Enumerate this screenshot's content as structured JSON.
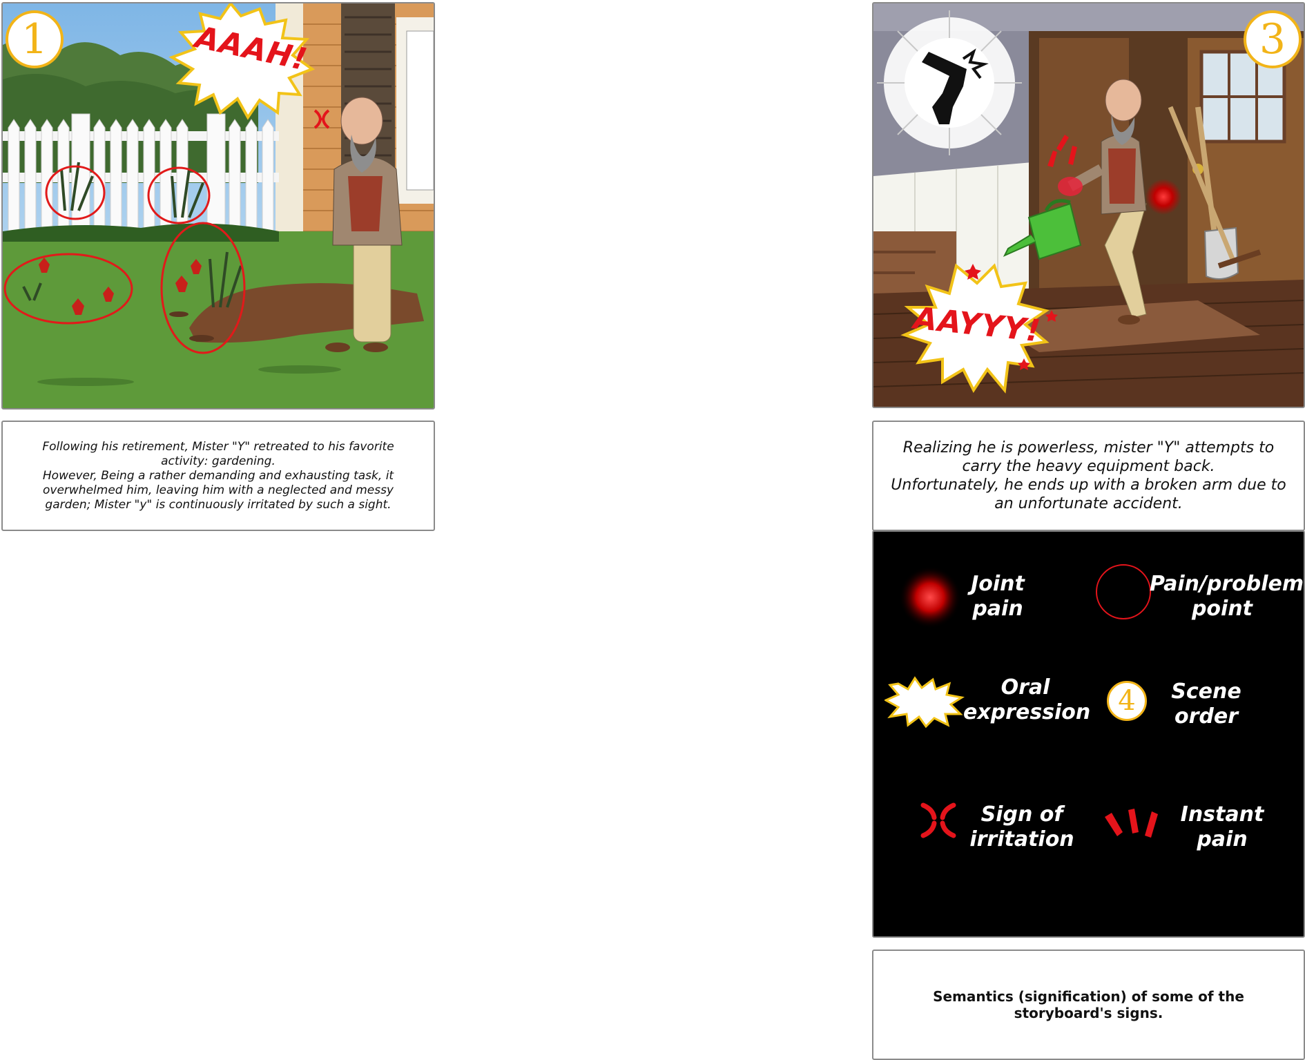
{
  "panel1": {
    "scene_number": "1",
    "exclamation": "AAAH!"
  },
  "caption1": {
    "lines": [
      "Following his retirement, Mister \"Y\" retreated to his favorite",
      "activity: gardening.",
      "However, Being a rather demanding and exhausting task, it",
      "overwhelmed him, leaving him with a neglected and messy",
      "garden; Mister \"y\" is continuously irritated by such a sight."
    ]
  },
  "panel3": {
    "scene_number": "3",
    "exclamation": "AAYYY!"
  },
  "caption3": {
    "lines": [
      "Realizing he is powerless, mister \"Y\" attempts to",
      "carry the heavy equipment back.",
      "Unfortunately, he ends up with a broken arm due to",
      "an unfortunate accident."
    ]
  },
  "legend": {
    "items": [
      {
        "icon": "joint-pain-glow-icon",
        "line1": "Joint",
        "line2": "pain"
      },
      {
        "icon": "red-circle-icon",
        "line1": "Pain/problem",
        "line2": "point"
      },
      {
        "icon": "speech-burst-icon",
        "line1": "Oral",
        "line2": "expression"
      },
      {
        "icon": "scene-number-icon",
        "number": "4",
        "line1": "Scene",
        "line2": "order"
      },
      {
        "icon": "irritation-sign-icon",
        "line1": "Sign of",
        "line2": "irritation"
      },
      {
        "icon": "instant-pain-marks-icon",
        "line1": "Instant",
        "line2": "pain"
      }
    ]
  },
  "caption_legend": {
    "text": "Semantics (signification) of some of the storyboard's signs."
  },
  "colors": {
    "scene_number": "#f2b418",
    "pain_red": "#e4141b",
    "legend_bg": "#000000",
    "grass": "#5e9a3a"
  }
}
